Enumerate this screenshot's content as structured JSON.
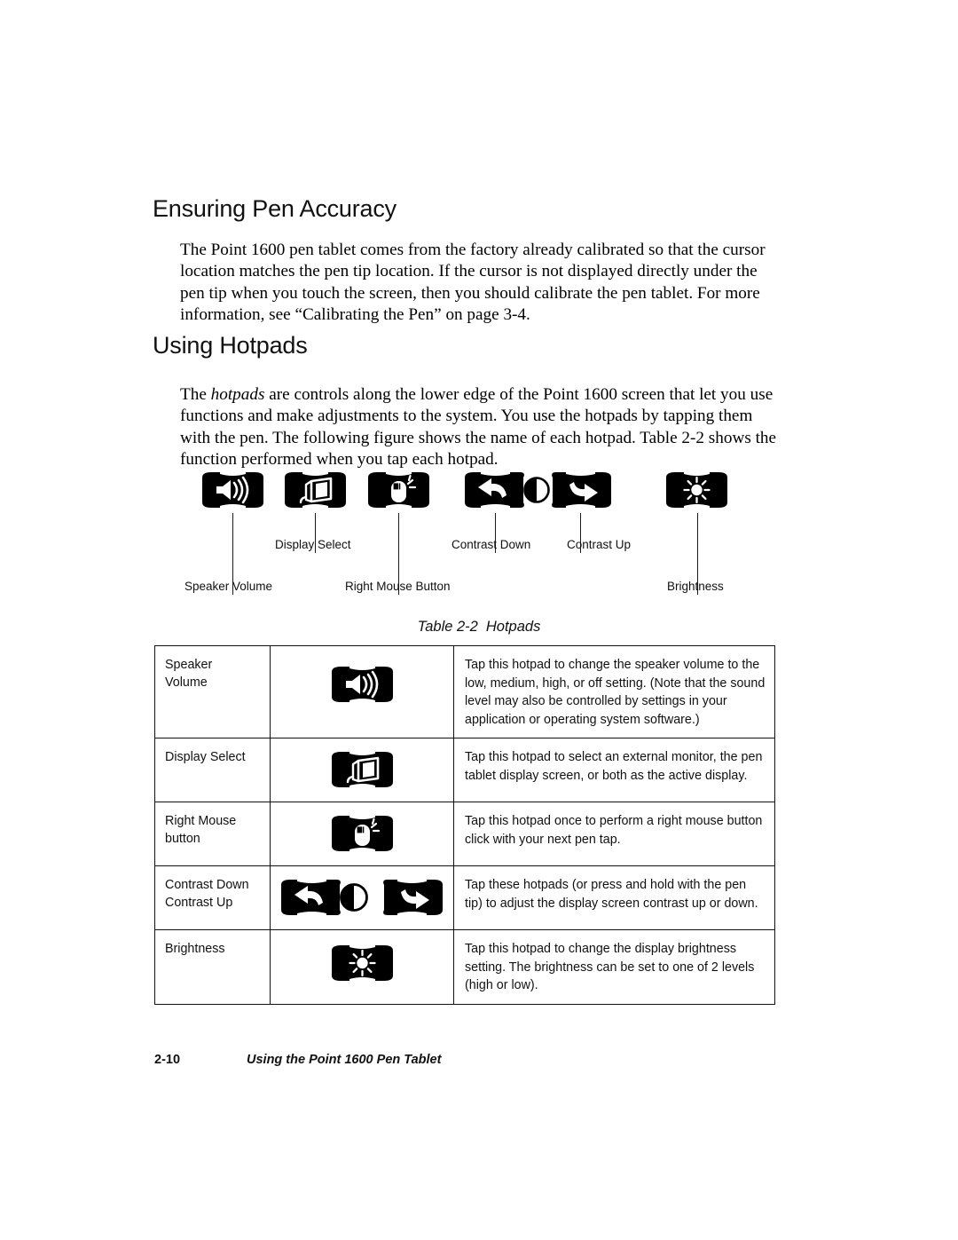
{
  "page": {
    "background": "#ffffff",
    "ink": "#000000"
  },
  "sections": [
    {
      "heading": "Ensuring Pen Accuracy",
      "paragraph": "The Point 1600 pen tablet comes from the factory already calibrated so that the cursor location matches the pen tip location. If the cursor is not displayed directly under the pen tip when you touch the screen, then you should calibrate the pen tablet. For more information, see “Calibrating the Pen” on page 3-4."
    },
    {
      "heading": "Using Hotpads",
      "paragraph_lead": "The ",
      "paragraph_emphasis": "hotpads",
      "paragraph_rest": " are controls along the lower edge of the Point 1600 screen that let you use functions and make adjustments to the system. You use the hotpads by tapping them with the pen. The following figure shows the name of each hotpad. Table 2-2 shows the function performed when you tap each hotpad."
    }
  ],
  "headings": {
    "pen_accuracy": "Ensuring Pen Accuracy",
    "using_hotpads": "Using Hotpads"
  },
  "figure": {
    "callouts": [
      {
        "label": "Speaker Volume",
        "icon": "speaker-volume-icon"
      },
      {
        "label": "Display Select",
        "icon": "display-select-icon"
      },
      {
        "label": "Right Mouse Button",
        "icon": "right-mouse-button-icon"
      },
      {
        "label": "Contrast Down",
        "icon": "contrast-down-icon"
      },
      {
        "label": "Contrast Up",
        "icon": "contrast-up-icon"
      },
      {
        "label": "Brightness",
        "icon": "brightness-icon"
      }
    ]
  },
  "table": {
    "caption_number": "Table 2-2",
    "caption_title": "Hotpads",
    "rows": [
      {
        "name": "Speaker\nVolume",
        "name_line1": "Speaker",
        "name_line2": "Volume",
        "icon": "speaker-volume-icon",
        "description": "Tap this hotpad to change the speaker volume to the low, medium, high, or off setting. (Note that the sound level may also be controlled by settings in your application or operating system software.)"
      },
      {
        "name_line1": "Display Select",
        "name_line2": "",
        "icon": "display-select-icon",
        "description": "Tap this hotpad to select an external monitor, the pen tablet display screen, or both as the active display."
      },
      {
        "name_line1": "Right Mouse",
        "name_line2": "button",
        "icon": "right-mouse-button-icon",
        "description": "Tap this hotpad once to perform a right mouse button click with your next pen tap."
      },
      {
        "name_line1": "Contrast Down",
        "name_line2": "Contrast Up",
        "icon": "contrast-group-icon",
        "description": "Tap these hotpads (or press and hold with the pen tip) to adjust the display screen contrast up or down."
      },
      {
        "name_line1": "Brightness",
        "name_line2": "",
        "icon": "brightness-icon",
        "description": "Tap this hotpad to change the display brightness setting. The brightness can be set to one of 2 levels (high or low)."
      }
    ]
  },
  "footer": {
    "page_number": "2-10",
    "running_head": "Using the Point 1600 Pen Tablet"
  }
}
